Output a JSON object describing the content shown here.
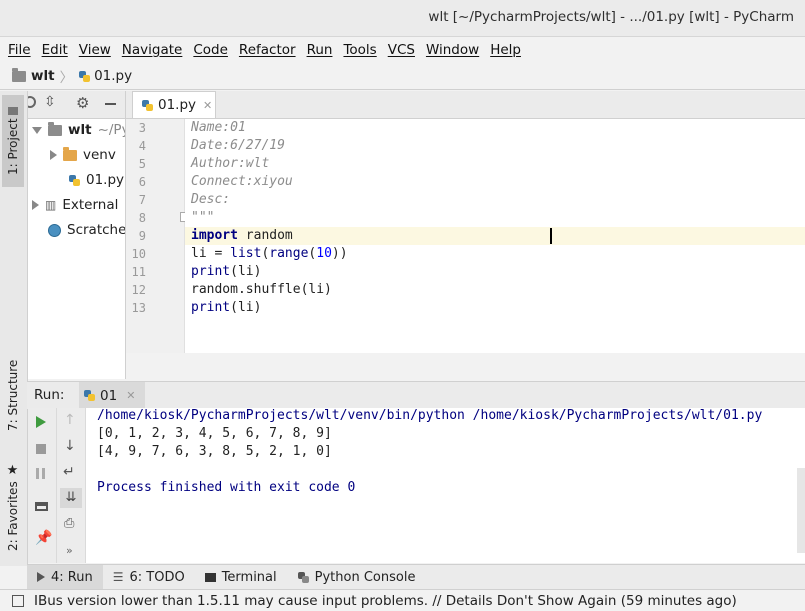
{
  "window": {
    "title": "wlt [~/PycharmProjects/wlt] - .../01.py [wlt] - PyCharm"
  },
  "menu": [
    "File",
    "Edit",
    "View",
    "Navigate",
    "Code",
    "Refactor",
    "Run",
    "Tools",
    "VCS",
    "Window",
    "Help"
  ],
  "breadcrumb": {
    "project": "wlt",
    "file": "01.py"
  },
  "left_strip": {
    "project": "1: Project",
    "structure": "7: Structure",
    "favorites": "2: Favorites"
  },
  "project_tree": [
    {
      "label": "wlt",
      "hint": "~/Py"
    },
    {
      "label": "venv"
    },
    {
      "label": "01.py"
    },
    {
      "label": "External"
    },
    {
      "label": "Scratche"
    }
  ],
  "editor": {
    "tab": "01.py",
    "lines": [
      {
        "n": "3",
        "text": "Name:01"
      },
      {
        "n": "4",
        "text": "Date:6/27/19"
      },
      {
        "n": "5",
        "text": "Author:wlt"
      },
      {
        "n": "6",
        "text": "Connect:xiyou"
      },
      {
        "n": "7",
        "text": "Desc:"
      },
      {
        "n": "8",
        "text": "\"\"\""
      },
      {
        "n": "9",
        "text": "import random"
      },
      {
        "n": "10",
        "text": "li = list(range(10))"
      },
      {
        "n": "11",
        "text": "print(li)"
      },
      {
        "n": "12",
        "text": "random.shuffle(li)"
      },
      {
        "n": "13",
        "text": "print(li)"
      }
    ]
  },
  "run": {
    "label": "Run:",
    "config": "01",
    "output": [
      "/home/kiosk/PycharmProjects/wlt/venv/bin/python /home/kiosk/PycharmProjects/wlt/01.py",
      "[0, 1, 2, 3, 4, 5, 6, 7, 8, 9]",
      "[4, 9, 7, 6, 3, 8, 5, 2, 1, 0]",
      "",
      "Process finished with exit code 0"
    ]
  },
  "bottom_tabs": [
    "4: Run",
    "6: TODO",
    "Terminal",
    "Python Console"
  ],
  "status": "IBus version lower than 1.5.11 may cause input problems. // Details Don't Show Again (59 minutes ago)",
  "colors": {
    "keyword": "#000080",
    "number": "#0000ff",
    "comment": "#8c8c8c",
    "console_path": "#000080"
  }
}
